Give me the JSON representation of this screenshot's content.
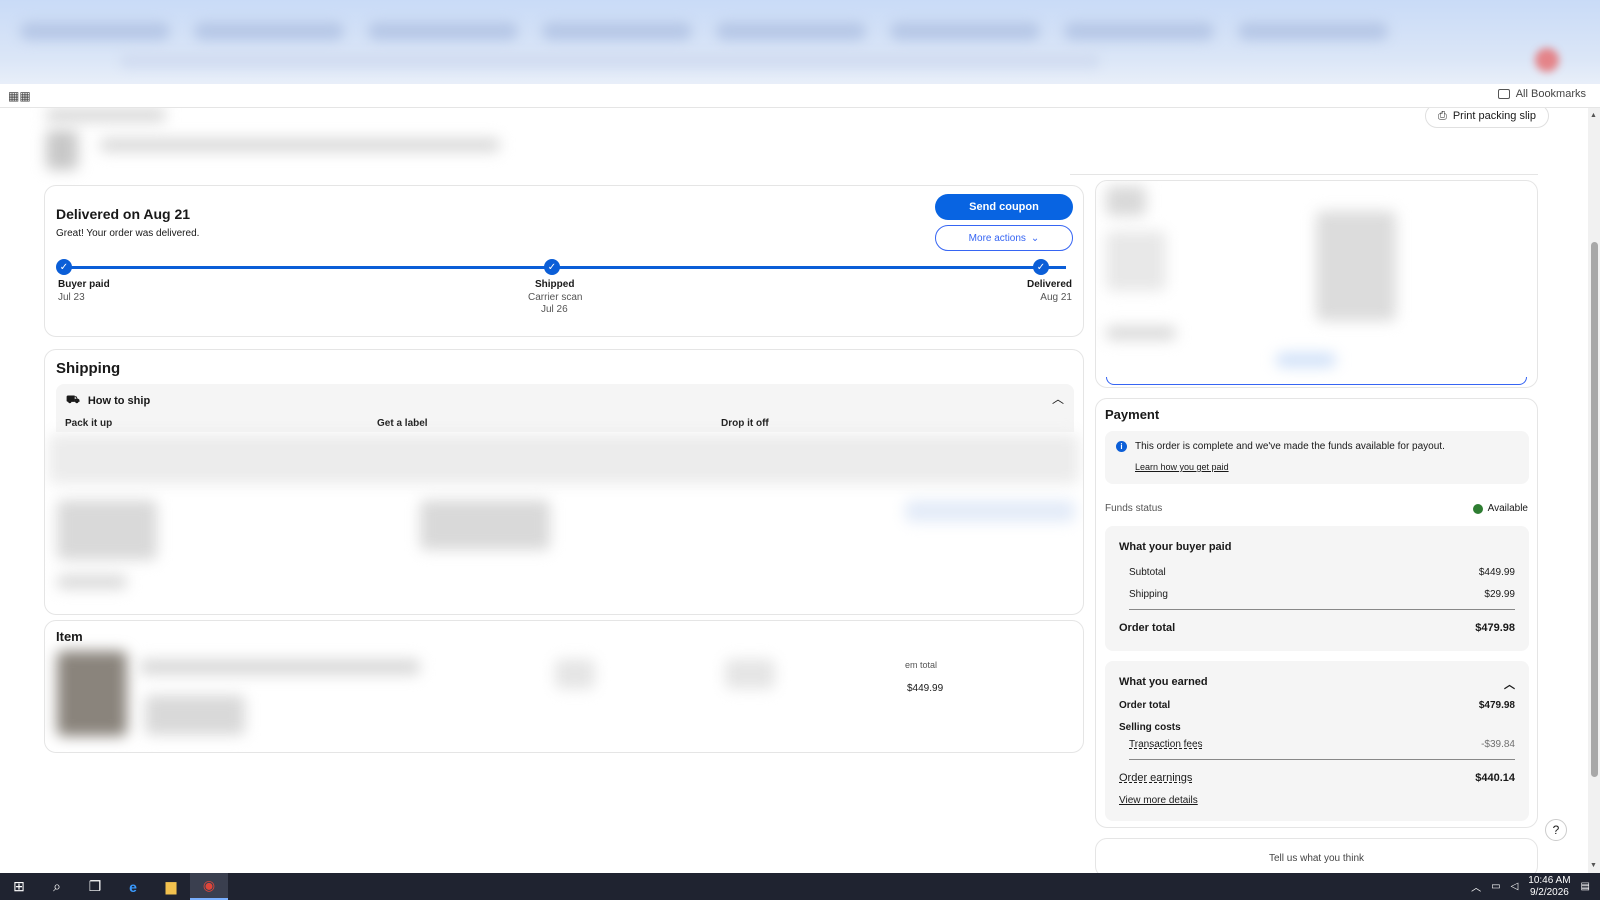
{
  "browser": {
    "all_bookmarks": "All Bookmarks",
    "apps_icon": "apps-grid-icon"
  },
  "header": {
    "print_packing_slip": "Print packing slip"
  },
  "delivery": {
    "title": "Delivered on Aug 21",
    "subtitle": "Great! Your order was delivered.",
    "send_coupon": "Send coupon",
    "more_actions": "More actions",
    "steps": [
      {
        "label": "Buyer paid",
        "date": "Jul 23"
      },
      {
        "label": "Shipped",
        "detail": "Carrier scan",
        "date": "Jul 26"
      },
      {
        "label": "Delivered",
        "date": "Aug 21"
      }
    ]
  },
  "shipping": {
    "title": "Shipping",
    "how_to_ship": "How to ship",
    "columns": [
      "Pack it up",
      "Get a label",
      "Drop it off"
    ]
  },
  "item": {
    "title": "Item",
    "item_total_label": "em total",
    "item_total_value": "$449.99"
  },
  "payment": {
    "title": "Payment",
    "info_text": "This order is complete and we've made the funds available for payout.",
    "info_link": "Learn how you get paid",
    "funds_status_label": "Funds status",
    "funds_status_value": "Available",
    "buyer_paid": {
      "title": "What your buyer paid",
      "subtotal_label": "Subtotal",
      "subtotal_value": "$449.99",
      "shipping_label": "Shipping",
      "shipping_value": "$29.99",
      "order_total_label": "Order total",
      "order_total_value": "$479.98"
    },
    "earned": {
      "title": "What you earned",
      "order_total_label": "Order total",
      "order_total_value": "$479.98",
      "selling_costs_label": "Selling costs",
      "transaction_fees_label": "Transaction fees",
      "transaction_fees_value": "-$39.84",
      "order_earnings_label": "Order earnings",
      "order_earnings_value": "$440.14",
      "view_more": "View more details"
    }
  },
  "feedback": {
    "text": "Tell us what you think"
  },
  "help": "?",
  "taskbar": {
    "time": "10:46 AM",
    "date": "9/2/2026"
  },
  "colors": {
    "primary_blue": "#0864e2",
    "track_blue": "#0b5ed7",
    "available_green": "#2e7d32"
  }
}
